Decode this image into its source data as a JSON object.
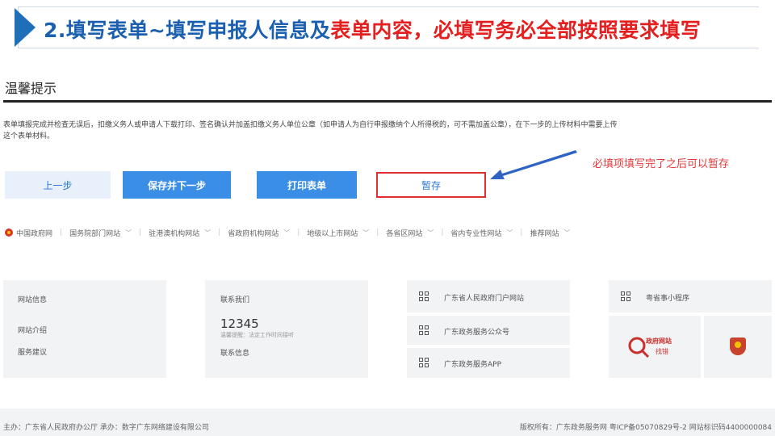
{
  "banner": {
    "title_part1": "2.填写表单~填写申报人信息及",
    "title_part2": "表单内容，必填写务必全部按照要求填写"
  },
  "tips": {
    "title": "温馨提示",
    "line1": "表单填报完成并检查无误后，扣缴义务人或申请人下载打印、签名确认并加盖扣缴义务人单位公章（如申请人为自行申报缴纳个人所得税的，可不需加盖公章），在下一步的上传材料中需要上传",
    "line2": "这个表单材料。"
  },
  "buttons": {
    "prev": "上一步",
    "save_next": "保存并下一步",
    "print": "打印表单",
    "temp_save": "暂存"
  },
  "annotation": "必填项填写完了之后可以暂存",
  "nav": {
    "gov": "中国政府网",
    "items": [
      "国务院部门网站",
      "驻港澳机构网站",
      "省政府机构网站",
      "地级以上市网站",
      "各省区网站",
      "省内专业性网站",
      "推荐网站"
    ]
  },
  "footer": {
    "site_info": "网站信息",
    "site_intro": "网站介绍",
    "service_advice": "服务建议",
    "contact_us": "联系我们",
    "hotline": "12345",
    "hotline_note": "温馨提醒：法定工作时间接听",
    "contact_info": "联系信息",
    "portal": "广东省人民政府门户网站",
    "wechat": "广东政务服务公众号",
    "app": "广东政务服务APP",
    "miniapp": "粤省事小程序",
    "gov_logo_top": "政府网站",
    "gov_logo_bottom": "找错"
  },
  "bottom": {
    "left": "主办：广东省人民政府办公厅    承办：数字广东网络建设有限公司",
    "right": "版权所有：广东政务服务网 粤ICP备05070829号-2 网站标识码4400000084"
  },
  "colors": {
    "accent_blue": "#3a8ee6",
    "title_blue": "#1a5fb0",
    "alert_red": "#e41f1f"
  }
}
